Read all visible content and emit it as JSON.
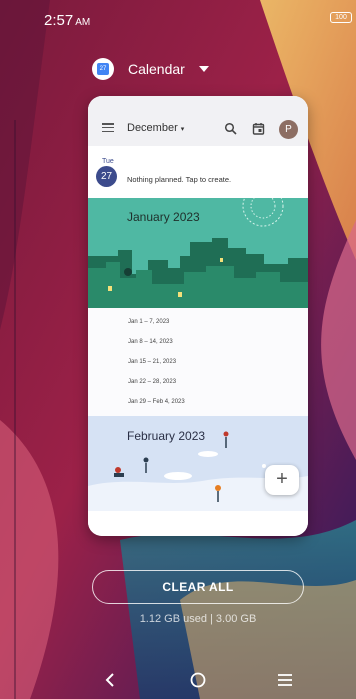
{
  "status_bar": {
    "time": "2:57",
    "ampm": "AM",
    "battery": "100"
  },
  "recent_app": {
    "title": "Calendar",
    "icon_day": "27"
  },
  "calendar": {
    "month_selector": "December",
    "avatar_letter": "P",
    "today": {
      "dow": "Tue",
      "date": "27",
      "message": "Nothing planned. Tap to create."
    },
    "january": {
      "title": "January 2023",
      "weeks": [
        "Jan 1 – 7, 2023",
        "Jan 8 – 14, 2023",
        "Jan 15 – 21, 2023",
        "Jan 22 – 28, 2023",
        "Jan 29 – Feb 4, 2023"
      ]
    },
    "february": {
      "title": "February 2023"
    },
    "fab_label": "+"
  },
  "clear_all_label": "CLEAR ALL",
  "memory": "1.12 GB used | 3.00 GB",
  "nav": {
    "back": "back-icon",
    "home": "home-icon",
    "recents": "recents-icon"
  },
  "colors": {
    "accent": "#3c4b8c",
    "january_banner": "#4fb8a3",
    "february_banner": "#d6e2f4"
  }
}
